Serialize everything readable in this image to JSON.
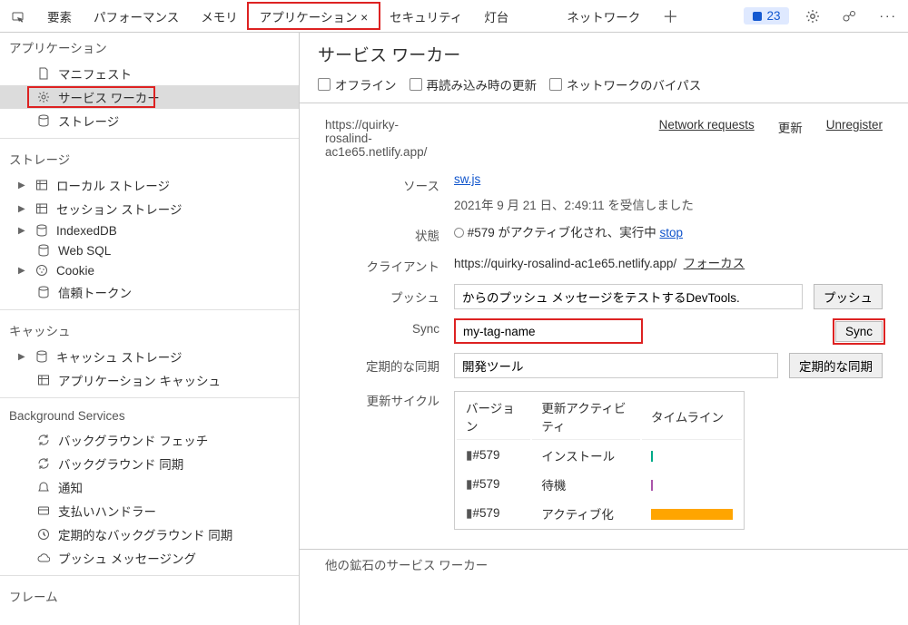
{
  "toolbar": {
    "tabs": [
      "要素",
      "パフォーマンス",
      "メモリ",
      "アプリケーション ×",
      "セキュリティ",
      "灯台",
      "ネットワーク"
    ],
    "issues_count": "23"
  },
  "sidebar": {
    "app_section": "アプリケーション",
    "app_items": [
      "マニフェスト",
      "サービス ワーカー",
      "ストレージ"
    ],
    "storage_section": "ストレージ",
    "storage_items": [
      "ローカル ストレージ",
      "セッション ストレージ",
      "IndexedDB",
      "Web SQL",
      "Cookie",
      "信頼トークン"
    ],
    "cache_section": "キャッシュ",
    "cache_items": [
      "キャッシュ ストレージ",
      "アプリケーション キャッシュ"
    ],
    "bg_section": "Background Services",
    "bg_items": [
      "バックグラウンド フェッチ",
      "バックグラウンド 同期",
      "通知",
      "支払いハンドラー",
      "定期的なバックグラウンド 同期",
      "プッシュ メッセージング"
    ],
    "frame_section": "フレーム"
  },
  "header": "サービス ワーカー",
  "options": {
    "offline": "オフライン",
    "reload": "再読み込み時の更新",
    "bypass": "ネットワークのバイパス"
  },
  "sw": {
    "url": "https://quirky-rosalind-ac1e65.netlify.app/",
    "net_req": "Network requests",
    "update": "更新",
    "unreg": "Unregister",
    "source_label": "ソース",
    "source_link": "sw.js",
    "received": "2021年 9 月 21 日、2:49:11 を受信しました",
    "status_label": "状態",
    "status_text": "#579 がアクティブ化され、実行中",
    "stop": "stop",
    "client_label": "クライアント",
    "client_url": "https://quirky-rosalind-ac1e65.netlify.app/",
    "focus": "フォーカス",
    "push_label": "プッシュ",
    "push_value": "からのプッシュ メッセージをテストするDevTools.",
    "push_btn": "プッシュ",
    "sync_label": "Sync",
    "sync_value": "my-tag-name",
    "sync_btn": "Sync",
    "periodic_label": "定期的な同期",
    "periodic_value": "開発ツール",
    "periodic_btn": "定期的な同期",
    "cycle_label": "更新サイクル",
    "cycle_head": [
      "バージョン",
      "更新アクティビティ",
      "タイムライン"
    ],
    "cycle_rows": [
      {
        "v": "#579",
        "act": "インストール",
        "bar": "tick"
      },
      {
        "v": "#579",
        "act": "待機",
        "bar": "tickb"
      },
      {
        "v": "#579",
        "act": "アクティブ化",
        "bar": "big"
      }
    ]
  },
  "other_sw": "他の鉱石のサービス ワーカー"
}
